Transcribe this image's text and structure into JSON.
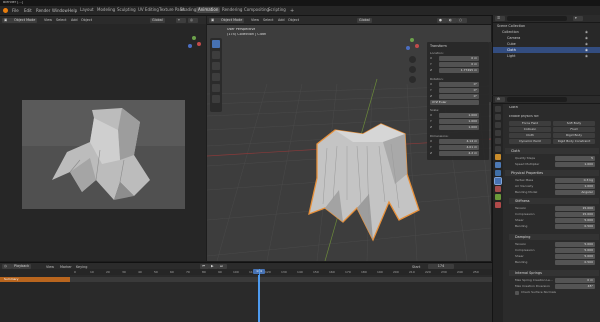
{
  "app": {
    "title": "Blender [...]"
  },
  "menu": [
    "File",
    "Edit",
    "Render",
    "Window",
    "Help"
  ],
  "workspaces": [
    {
      "label": "Layout",
      "active": false
    },
    {
      "label": "Modeling",
      "active": false
    },
    {
      "label": "Sculpting",
      "active": false
    },
    {
      "label": "UV Editing",
      "active": false
    },
    {
      "label": "Texture Paint",
      "active": false
    },
    {
      "label": "Shading",
      "active": false
    },
    {
      "label": "Animation",
      "active": true
    },
    {
      "label": "Rendering",
      "active": false
    },
    {
      "label": "Compositing",
      "active": false
    },
    {
      "label": "Scripting",
      "active": false
    }
  ],
  "left_view": {
    "mode": "Object Mode",
    "menus": [
      "View",
      "Select",
      "Add",
      "Object"
    ],
    "orientation": "Global"
  },
  "main_view": {
    "mode": "Object Mode",
    "menus": [
      "View",
      "Select",
      "Add",
      "Object"
    ],
    "orientation": "Global",
    "overlay_title": "User Perspective",
    "overlay_sub": "(174) Collection | Cloth"
  },
  "n_panel": {
    "title": "Transform",
    "location_label": "Location:",
    "location": [
      {
        "axis": "X",
        "value": "0 m"
      },
      {
        "axis": "Y",
        "value": "0 m"
      },
      {
        "axis": "Z",
        "value": "1.77495 m"
      }
    ],
    "rotation_label": "Rotation:",
    "rotation": [
      {
        "axis": "X",
        "value": "0°"
      },
      {
        "axis": "Y",
        "value": "0°"
      },
      {
        "axis": "Z",
        "value": "0°"
      }
    ],
    "rotation_mode": "XYZ Euler",
    "scale_label": "Scale:",
    "scale": [
      {
        "axis": "X",
        "value": "1.000"
      },
      {
        "axis": "Y",
        "value": "1.000"
      },
      {
        "axis": "Z",
        "value": "1.000"
      }
    ],
    "dimensions_label": "Dimensions:",
    "dimensions": [
      {
        "axis": "X",
        "value": "4.14 m"
      },
      {
        "axis": "Y",
        "value": "4.01 m"
      },
      {
        "axis": "Z",
        "value": "4.2 m"
      }
    ]
  },
  "outliner": {
    "rows": [
      {
        "label": "Scene Collection",
        "indent": 0,
        "selected": false
      },
      {
        "label": "Collection",
        "indent": 1,
        "selected": false
      },
      {
        "label": "Camera",
        "indent": 2,
        "selected": false
      },
      {
        "label": "Cube",
        "indent": 2,
        "selected": false
      },
      {
        "label": "Cloth",
        "indent": 2,
        "selected": true
      },
      {
        "label": "Light",
        "indent": 2,
        "selected": false
      }
    ]
  },
  "properties": {
    "object": "Cloth",
    "enable_physics": "Enable physics for:",
    "buttons": [
      "Force Field",
      "Soft Body",
      "Collision",
      "Fluid",
      "Cloth",
      "Rigid Body",
      "Dynamic Paint",
      "Rigid Body Constraint"
    ],
    "sections": [
      {
        "title": "Cloth",
        "rows": [
          {
            "label": "Quality Steps",
            "value": "5"
          },
          {
            "label": "Speed Multiplier",
            "value": "1.000"
          }
        ]
      },
      {
        "title": "Physical Properties",
        "rows": [
          {
            "label": "Vertex Mass",
            "value": "0.3 kg"
          },
          {
            "label": "Air Viscosity",
            "value": "1.000"
          },
          {
            "label": "Bending Model",
            "value": "Angular"
          }
        ]
      },
      {
        "title": "Stiffness",
        "rows": [
          {
            "label": "Tension",
            "value": "15.000"
          },
          {
            "label": "Compression",
            "value": "15.000"
          },
          {
            "label": "Shear",
            "value": "5.000"
          },
          {
            "label": "Bending",
            "value": "0.500"
          }
        ]
      },
      {
        "title": "Damping",
        "rows": [
          {
            "label": "Tension",
            "value": "5.000"
          },
          {
            "label": "Compression",
            "value": "5.000"
          },
          {
            "label": "Shear",
            "value": "5.000"
          },
          {
            "label": "Bending",
            "value": "0.500"
          }
        ]
      },
      {
        "title": "Internal Springs",
        "rows": [
          {
            "label": "Max Spring Creation Le...",
            "value": "0 m"
          },
          {
            "label": "Max Creation Diversion",
            "value": "45°"
          },
          {
            "label": "Check Surface Normals",
            "value": ""
          }
        ]
      }
    ]
  },
  "timeline": {
    "playback": "Playback",
    "menus": [
      "View",
      "Marker"
    ],
    "keying": "Keying",
    "frame_label": "Start",
    "current_frame": "174",
    "ticks": [
      "0",
      "10",
      "20",
      "30",
      "40",
      "50",
      "60",
      "70",
      "80",
      "90",
      "100",
      "110",
      "120",
      "130",
      "140",
      "150",
      "160",
      "170",
      "180",
      "190",
      "200",
      "210",
      "220",
      "230",
      "240",
      "250"
    ],
    "summary": "Summary"
  }
}
